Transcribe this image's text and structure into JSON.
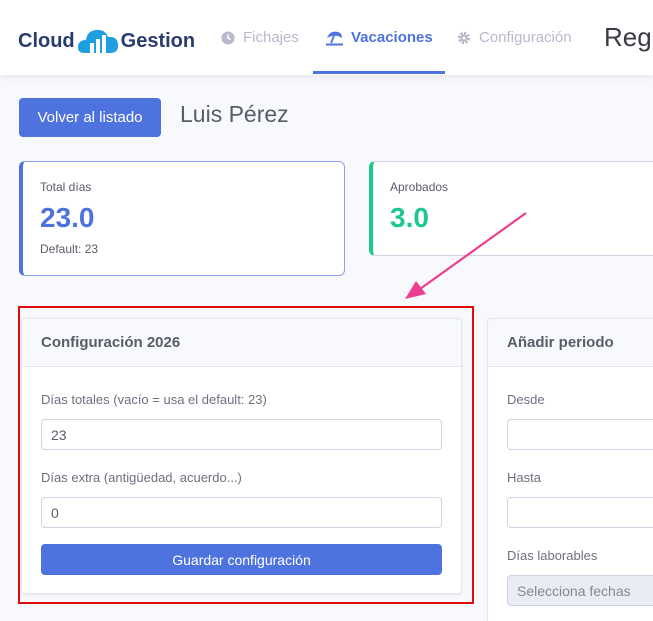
{
  "header": {
    "logo_left": "Cloud",
    "logo_right": "Gestion",
    "nav": [
      {
        "label": "Fichajes",
        "icon": "clock-icon"
      },
      {
        "label": "Vacaciones",
        "icon": "beach-umbrella-icon",
        "active": true
      },
      {
        "label": "Configuración",
        "icon": "gear-icon"
      }
    ],
    "nav_overflow": "Reg"
  },
  "toolbar": {
    "back_label": "Volver al listado",
    "employee_name": "Luis Pérez"
  },
  "stats": {
    "total": {
      "label": "Total días",
      "value": "23.0",
      "note": "Default: 23"
    },
    "approved": {
      "label": "Aprobados",
      "value": "3.0"
    }
  },
  "config_card": {
    "title": "Configuración 2026",
    "total_days_label": "Días totales (vacío = usa el default: 23)",
    "total_days_value": "23",
    "extra_days_label": "Días extra (antigüedad, acuerdo...)",
    "extra_days_value": "0",
    "save_label": "Guardar configuración"
  },
  "period_card": {
    "title": "Añadir periodo",
    "from_label": "Desde",
    "to_label": "Hasta",
    "workdays_label": "Días laborables",
    "workdays_placeholder": "Selecciona fechas"
  },
  "colors": {
    "primary": "#4e73df",
    "success": "#1cc88a",
    "annotation_red": "#e00a0a",
    "annotation_pink": "#ee3d8f"
  }
}
